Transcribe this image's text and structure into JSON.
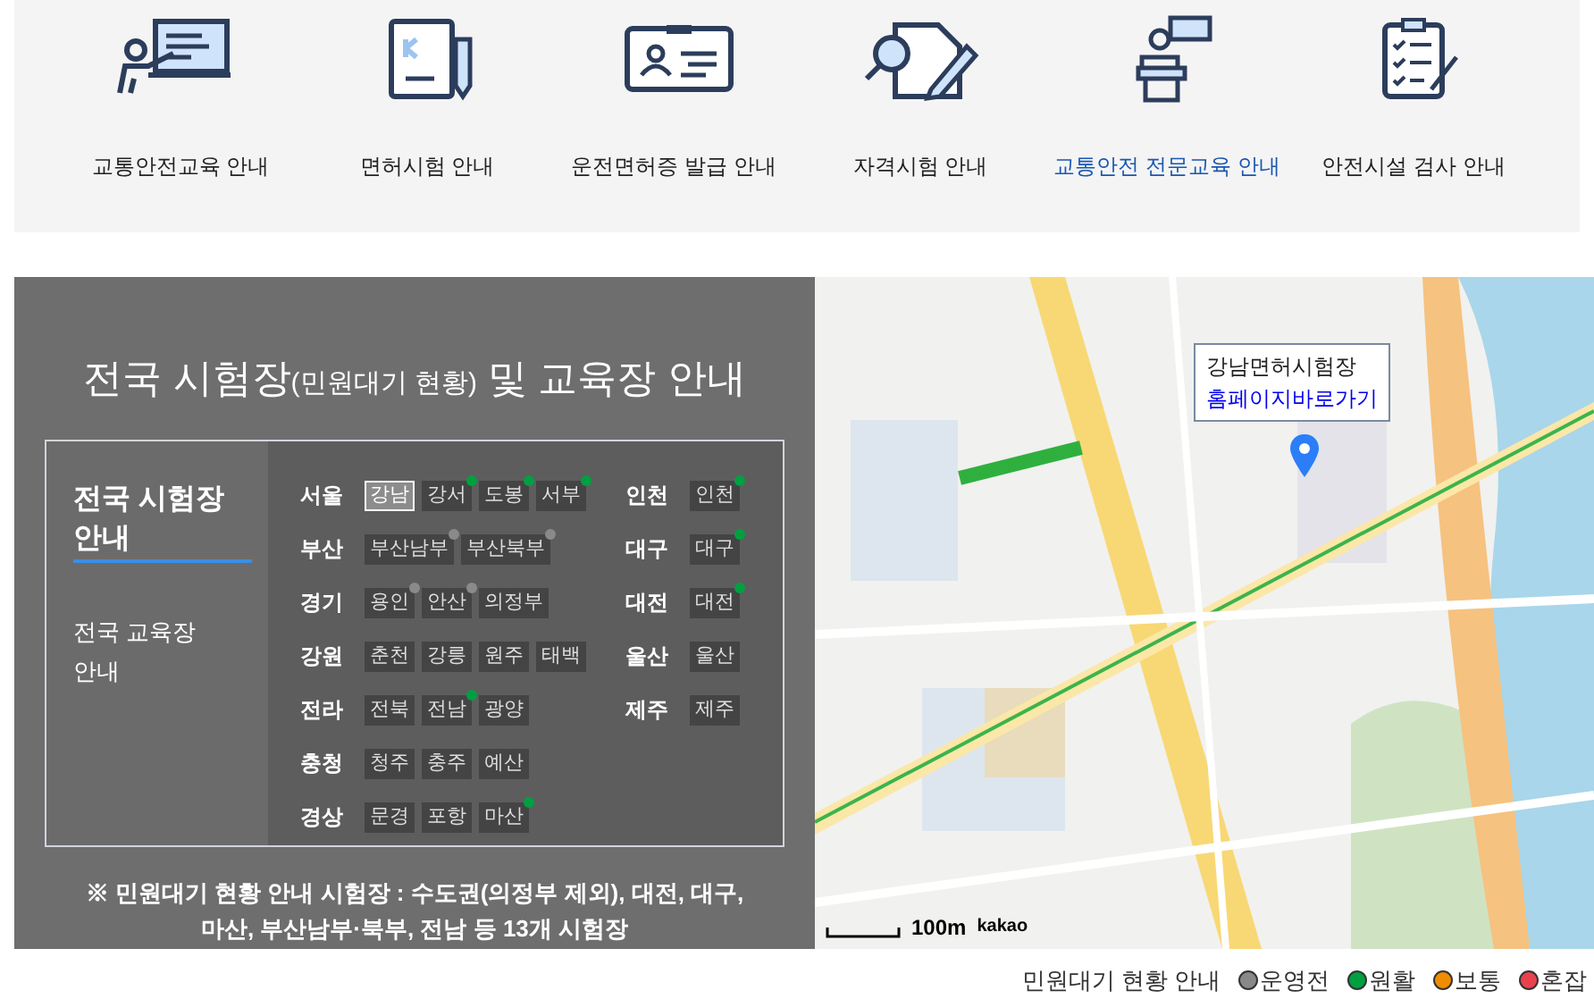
{
  "menu": [
    {
      "label": "교통안전교육 안내",
      "kind": "teacher",
      "selected": false
    },
    {
      "label": "면허시험 안내",
      "kind": "notebook",
      "selected": false
    },
    {
      "label": "운전면허증 발급 안내",
      "kind": "idcard",
      "selected": false
    },
    {
      "label": "자격시험 안내",
      "kind": "document",
      "selected": false
    },
    {
      "label": "교통안전 전문교육 안내",
      "kind": "speaker",
      "selected": true
    },
    {
      "label": "안전시설 검사 안내",
      "kind": "checklist",
      "selected": false
    }
  ],
  "panel": {
    "title": "전국 시험장",
    "title_note": "(민원대기 현황)",
    "title_tail": "및 교육장 안내",
    "tabs": [
      {
        "label": "전국 시험장 안내",
        "selected": true
      },
      {
        "label": "전국 교육장 안내",
        "selected": false
      }
    ],
    "regions_left": [
      {
        "name": "서울",
        "sites": [
          {
            "name": "강남",
            "selected": true
          },
          {
            "name": "강서",
            "selected": false,
            "color": "#00a040"
          },
          {
            "name": "도봉",
            "selected": false,
            "color": "#00a040"
          },
          {
            "name": "서부",
            "selected": false,
            "color": "#00a040"
          }
        ]
      },
      {
        "name": "부산",
        "sites": [
          {
            "name": "부산남부",
            "selected": false,
            "color": "#8a8a8a"
          },
          {
            "name": "부산북부",
            "selected": false,
            "color": "#8a8a8a"
          }
        ]
      },
      {
        "name": "경기",
        "sites": [
          {
            "name": "용인",
            "selected": false,
            "color": "#8a8a8a"
          },
          {
            "name": "안산",
            "selected": false,
            "color": "#8a8a8a"
          },
          {
            "name": "의정부",
            "selected": false
          }
        ]
      },
      {
        "name": "강원",
        "sites": [
          {
            "name": "춘천",
            "selected": false
          },
          {
            "name": "강릉",
            "selected": false
          },
          {
            "name": "원주",
            "selected": false
          },
          {
            "name": "태백",
            "selected": false
          }
        ]
      },
      {
        "name": "전라",
        "sites": [
          {
            "name": "전북",
            "selected": false
          },
          {
            "name": "전남",
            "selected": false,
            "color": "#00a040"
          },
          {
            "name": "광양",
            "selected": false
          }
        ]
      },
      {
        "name": "충청",
        "sites": [
          {
            "name": "청주",
            "selected": false
          },
          {
            "name": "충주",
            "selected": false
          },
          {
            "name": "예산",
            "selected": false
          }
        ]
      },
      {
        "name": "경상",
        "sites": [
          {
            "name": "문경",
            "selected": false
          },
          {
            "name": "포항",
            "selected": false
          },
          {
            "name": "마산",
            "selected": false,
            "color": "#00a040"
          }
        ]
      }
    ],
    "regions_right": [
      {
        "name": "인천",
        "sites": [
          {
            "name": "인천",
            "selected": false,
            "color": "#00a040"
          }
        ]
      },
      {
        "name": "대구",
        "sites": [
          {
            "name": "대구",
            "selected": false,
            "color": "#00a040"
          }
        ]
      },
      {
        "name": "대전",
        "sites": [
          {
            "name": "대전",
            "selected": false,
            "color": "#00a040"
          }
        ]
      },
      {
        "name": "울산",
        "sites": [
          {
            "name": "울산",
            "selected": false
          }
        ]
      },
      {
        "name": "제주",
        "sites": [
          {
            "name": "제주",
            "selected": false
          }
        ]
      }
    ],
    "note": "※ 민원대기 현황 안내 시험장 : 수도권(의정부 제외), 대전, 대구, 마산, 부산남부·북부, 전남 등 13개 시험장"
  },
  "map": {
    "popup_title": "강남면허시험장",
    "popup_link": "홈페이지바로가기",
    "scale": "100m",
    "attribution": "kakao"
  },
  "legend": {
    "label": "민원대기 현황 안내",
    "items": [
      {
        "label": "운영전",
        "color": "#888888"
      },
      {
        "label": "원활",
        "color": "#00a040"
      },
      {
        "label": "보통",
        "color": "#f08c00"
      },
      {
        "label": "혼잡",
        "color": "#e8424f"
      }
    ]
  }
}
